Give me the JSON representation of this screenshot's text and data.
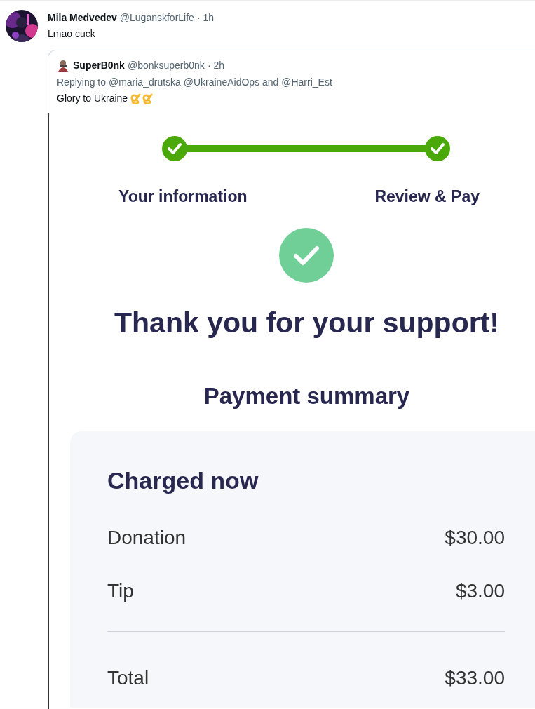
{
  "post": {
    "author": "Mila Medvedev",
    "handle": "@LuganskforLife",
    "time": "· 1h",
    "text": "Lmao cuck"
  },
  "quoted_post": {
    "author": "SuperB0nk",
    "handle": "@bonksuperb0nk",
    "time": "· 2h",
    "replying_to": "Replying to @maria_drutska @UkraineAidOps and @Harri_Est",
    "text": "Glory to Ukraine"
  },
  "checkout": {
    "steps": [
      {
        "label": "Your information",
        "completed": true
      },
      {
        "label": "Review & Pay",
        "completed": true
      }
    ],
    "heading": "Thank you for your support!",
    "subheading": "Payment summary",
    "summary": {
      "title": "Charged now",
      "rows": [
        {
          "label": "Donation",
          "amount": "$30.00"
        },
        {
          "label": "Tip",
          "amount": "$3.00"
        }
      ],
      "total": {
        "label": "Total",
        "amount": "$33.00"
      }
    }
  }
}
